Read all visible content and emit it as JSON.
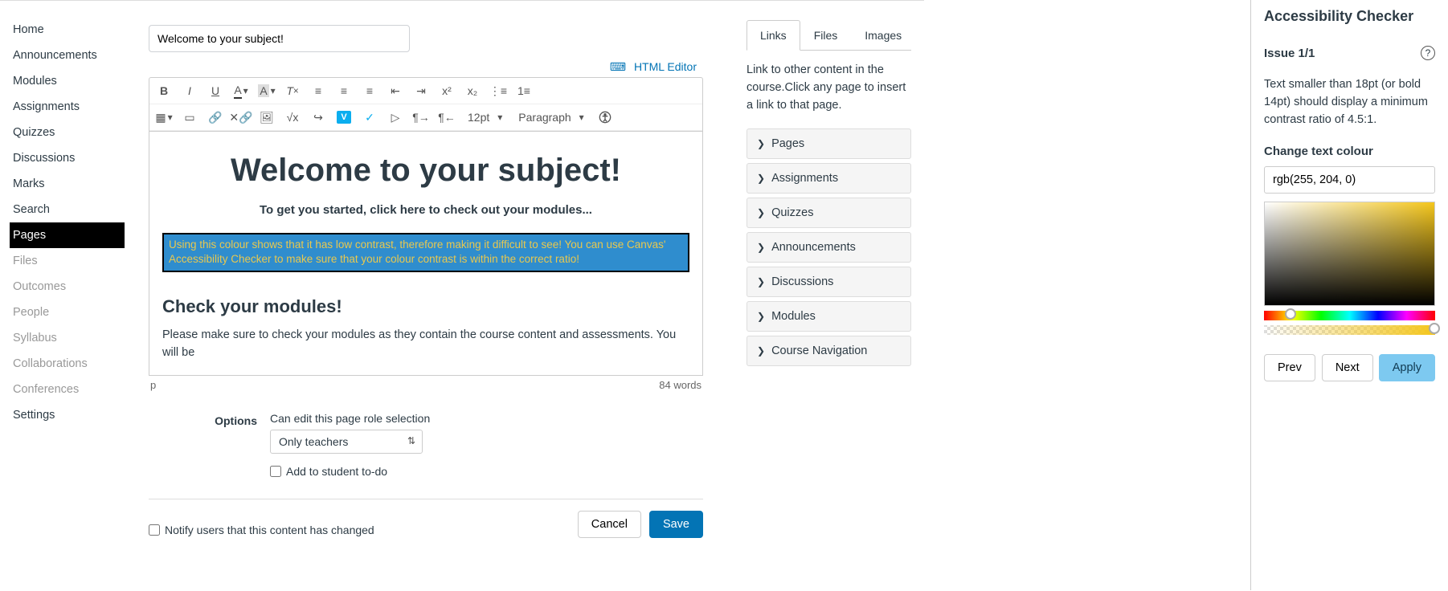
{
  "sidebar": {
    "items": [
      {
        "label": "Home",
        "active": false,
        "dim": false
      },
      {
        "label": "Announcements",
        "active": false,
        "dim": false
      },
      {
        "label": "Modules",
        "active": false,
        "dim": false
      },
      {
        "label": "Assignments",
        "active": false,
        "dim": false
      },
      {
        "label": "Quizzes",
        "active": false,
        "dim": false
      },
      {
        "label": "Discussions",
        "active": false,
        "dim": false
      },
      {
        "label": "Marks",
        "active": false,
        "dim": false
      },
      {
        "label": "Search",
        "active": false,
        "dim": false
      },
      {
        "label": "Pages",
        "active": true,
        "dim": false
      },
      {
        "label": "Files",
        "active": false,
        "dim": true
      },
      {
        "label": "Outcomes",
        "active": false,
        "dim": true
      },
      {
        "label": "People",
        "active": false,
        "dim": true
      },
      {
        "label": "Syllabus",
        "active": false,
        "dim": true
      },
      {
        "label": "Collaborations",
        "active": false,
        "dim": true
      },
      {
        "label": "Conferences",
        "active": false,
        "dim": true
      },
      {
        "label": "Settings",
        "active": false,
        "dim": false
      }
    ]
  },
  "main": {
    "title_value": "Welcome to your subject!",
    "html_editor_label": "HTML Editor",
    "toolbar": {
      "font_size": "12pt",
      "paragraph": "Paragraph"
    },
    "content": {
      "h1": "Welcome to your subject!",
      "subtitle": "To get you started, click here to check out your modules...",
      "highlighted": "Using this colour shows that it has low contrast, therefore making it difficult to see! You can use Canvas' Accessibility Checker to make sure that your colour contrast is within the correct ratio!",
      "h2": "Check your modules!",
      "body": "Please make sure to check your modules as they contain the course content and assessments. You will be"
    },
    "footer": {
      "path": "p",
      "word_count": "84 words"
    },
    "options": {
      "label": "Options",
      "role_desc": "Can edit this page role selection",
      "role_value": "Only teachers",
      "todo_label": "Add to student to-do"
    },
    "notify_label": "Notify users that this content has changed",
    "cancel": "Cancel",
    "save": "Save"
  },
  "right": {
    "tabs": [
      {
        "label": "Links",
        "active": true
      },
      {
        "label": "Files",
        "active": false
      },
      {
        "label": "Images",
        "active": false
      }
    ],
    "description": "Link to other content in the course.Click any page to insert a link to that page.",
    "accordion": [
      "Pages",
      "Assignments",
      "Quizzes",
      "Announcements",
      "Discussions",
      "Modules",
      "Course Navigation"
    ]
  },
  "a11y": {
    "title": "Accessibility Checker",
    "issue_label": "Issue 1/1",
    "description": "Text smaller than 18pt (or bold 14pt) should display a minimum contrast ratio of 4.5:1.",
    "field_label": "Change text colour",
    "color_value": "rgb(255, 204, 0)",
    "prev": "Prev",
    "next": "Next",
    "apply": "Apply"
  }
}
